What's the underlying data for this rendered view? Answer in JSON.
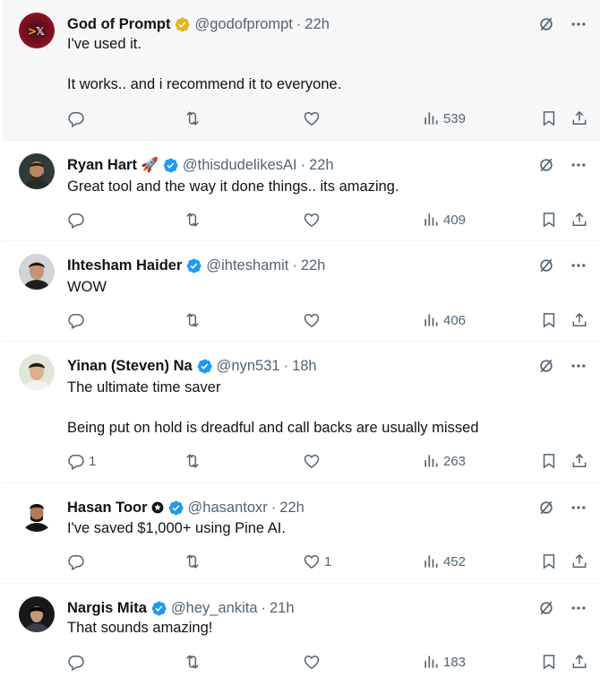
{
  "tweets": [
    {
      "name": "God of Prompt",
      "badge": "gold-verified",
      "handle": "@godofprompt",
      "time": "22h",
      "paragraphs": [
        "I've used it.",
        "It works.. and i recommend it to everyone."
      ],
      "replies": "",
      "likes": "",
      "views": "539"
    },
    {
      "name": "Ryan Hart",
      "emoji": "🚀",
      "badge": "blue-verified",
      "handle": "@thisdudelikesAI",
      "time": "22h",
      "paragraphs": [
        "Great tool and the way it done things.. its amazing."
      ],
      "replies": "",
      "likes": "",
      "views": "409"
    },
    {
      "name": "Ihtesham Haider",
      "badge": "blue-verified",
      "handle": "@ihteshamit",
      "time": "22h",
      "paragraphs": [
        "WOW"
      ],
      "replies": "",
      "likes": "",
      "views": "406"
    },
    {
      "name": "Yinan (Steven) Na",
      "badge": "blue-verified",
      "handle": "@nyn531",
      "time": "18h",
      "paragraphs": [
        "The ultimate time saver",
        "Being put on hold is dreadful and call backs are usually missed"
      ],
      "replies": "1",
      "likes": "",
      "views": "263"
    },
    {
      "name": "Hasan Toor",
      "affiliate": "affiliate-badge-icon",
      "badge": "blue-verified",
      "handle": "@hasantoxr",
      "time": "22h",
      "paragraphs": [
        "I've saved $1,000+ using Pine AI."
      ],
      "replies": "",
      "likes": "1",
      "views": "452"
    },
    {
      "name": "Nargis Mita",
      "badge": "blue-verified",
      "handle": "@hey_ankita",
      "time": "21h",
      "paragraphs": [
        "That sounds amazing!"
      ],
      "replies": "",
      "likes": "",
      "views": "183"
    }
  ],
  "colors": {
    "verified_blue": "#1d9bf0",
    "verified_gold": "#e2b719",
    "secondary_text": "#536471",
    "primary_text": "#0f1419",
    "highlight_bg": "#f7f7f7"
  }
}
